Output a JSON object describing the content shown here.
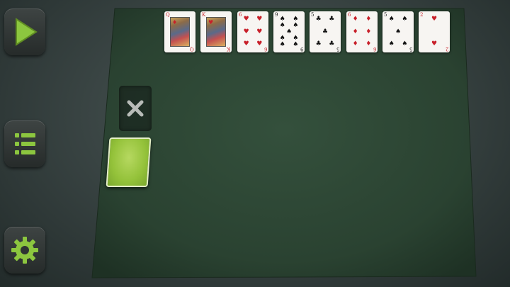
{
  "felt_color": "#2f4a36",
  "felt_dark": "#243a2a",
  "accent_green": "#8cc63f",
  "buttons": [
    {
      "name": "play-button",
      "icon": "play-icon"
    },
    {
      "name": "menu-button",
      "icon": "menu-list-icon"
    },
    {
      "name": "settings-button",
      "icon": "gear-icon"
    }
  ],
  "stock": {
    "icon": "close-x-icon"
  },
  "foundation_cards": [
    {
      "rank": "Q",
      "suit": "♦",
      "color": "red",
      "face": true
    },
    {
      "rank": "K",
      "suit": "♥",
      "color": "red",
      "face": true
    },
    {
      "rank": "6",
      "suit": "♥",
      "color": "red",
      "face": false
    },
    {
      "rank": "9",
      "suit": "♠",
      "color": "black",
      "face": false
    },
    {
      "rank": "5",
      "suit": "♣",
      "color": "black",
      "face": false
    },
    {
      "rank": "6",
      "suit": "♦",
      "color": "red",
      "face": false
    },
    {
      "rank": "5",
      "suit": "♠",
      "color": "black",
      "face": false
    },
    {
      "rank": "2",
      "suit": "♥",
      "color": "red",
      "face": false
    }
  ]
}
